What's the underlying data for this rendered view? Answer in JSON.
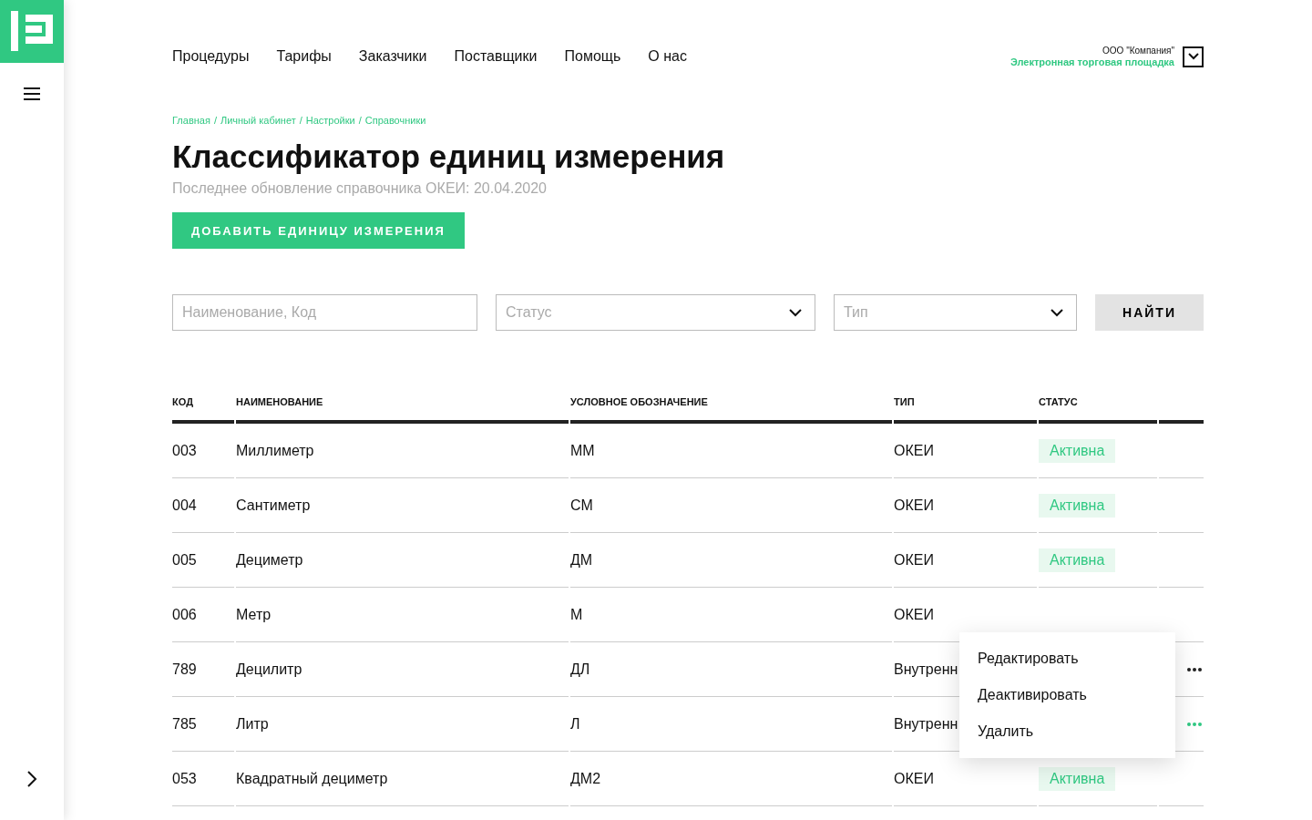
{
  "nav": [
    "Процедуры",
    "Тарифы",
    "Заказчики",
    "Поставщики",
    "Помощь",
    "О нас"
  ],
  "account": {
    "company": "ООО \"Компания\"",
    "platform": "Электронная торговая площадка"
  },
  "breadcrumbs": [
    "Главная",
    "Личный кабинет",
    "Настройки",
    "Справочники"
  ],
  "breadcrumb_separator": "/",
  "title": "Классификатор единиц измерения",
  "subtitle": "Последнее обновление справочника ОКЕИ: 20.04.2020",
  "add_button": "ДОБАВИТЬ ЕДИНИЦУ ИЗМЕРЕНИЯ",
  "filters": {
    "search_placeholder": "Наименование, Код",
    "status_placeholder": "Статус",
    "type_placeholder": "Тип",
    "find_button": "НАЙТИ"
  },
  "table": {
    "columns": [
      "КОД",
      "НАИМЕНОВАНИЕ",
      "УСЛОВНОЕ ОБОЗНАЧЕНИЕ",
      "ТИП",
      "СТАТУС"
    ],
    "rows": [
      {
        "code": "003",
        "name": "Миллиметр",
        "symbol": "ММ",
        "type": "ОКЕИ",
        "status": "Активна"
      },
      {
        "code": "004",
        "name": "Сантиметр",
        "symbol": "СМ",
        "type": "ОКЕИ",
        "status": "Активна"
      },
      {
        "code": "005",
        "name": "Дециметр",
        "symbol": "ДМ",
        "type": "ОКЕИ",
        "status": "Активна"
      },
      {
        "code": "006",
        "name": "Метр",
        "symbol": "М",
        "type": "ОКЕИ"
      },
      {
        "code": "789",
        "name": "Децилитр",
        "symbol": "ДЛ",
        "type": "Внутренн",
        "has_menu": true,
        "selected": false
      },
      {
        "code": "785",
        "name": "Литр",
        "symbol": "Л",
        "type": "Внутренн",
        "has_menu": true,
        "selected": true
      },
      {
        "code": "053",
        "name": "Квадратный дециметр",
        "symbol": "ДМ2",
        "type": "ОКЕИ",
        "status": "Активна"
      }
    ]
  },
  "context_menu": [
    "Редактировать",
    "Деактивировать",
    "Удалить"
  ]
}
